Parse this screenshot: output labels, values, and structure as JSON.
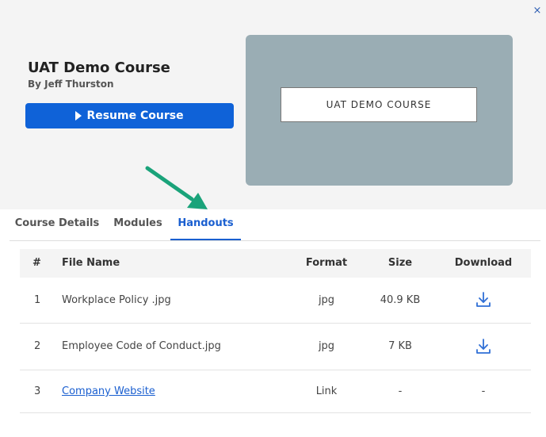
{
  "course": {
    "title": "UAT Demo Course",
    "author": "By Jeff Thurston",
    "resume_label": "Resume Course",
    "thumbnail_text": "UAT DEMO COURSE"
  },
  "close_label": "×",
  "tabs": [
    {
      "label": "Course Details",
      "active": false
    },
    {
      "label": "Modules",
      "active": false
    },
    {
      "label": "Handouts",
      "active": true
    }
  ],
  "handouts": {
    "columns": [
      "#",
      "File Name",
      "Format",
      "Size",
      "Download"
    ],
    "rows": [
      {
        "num": "1",
        "name": "Workplace Policy .jpg",
        "format": "jpg",
        "size": "40.9 KB",
        "download": "download-icon",
        "is_link": false
      },
      {
        "num": "2",
        "name": "Employee Code of Conduct.jpg",
        "format": "jpg",
        "size": "7 KB",
        "download": "download-icon",
        "is_link": false
      },
      {
        "num": "3",
        "name": "Company Website",
        "format": "Link",
        "size": "-",
        "download": "-",
        "is_link": true
      }
    ]
  },
  "colors": {
    "accent": "#0f62d8",
    "active_tab": "#1a5fd0",
    "annotation_arrow": "#1aa37a",
    "thumbnail_bg": "#9aadb4"
  }
}
